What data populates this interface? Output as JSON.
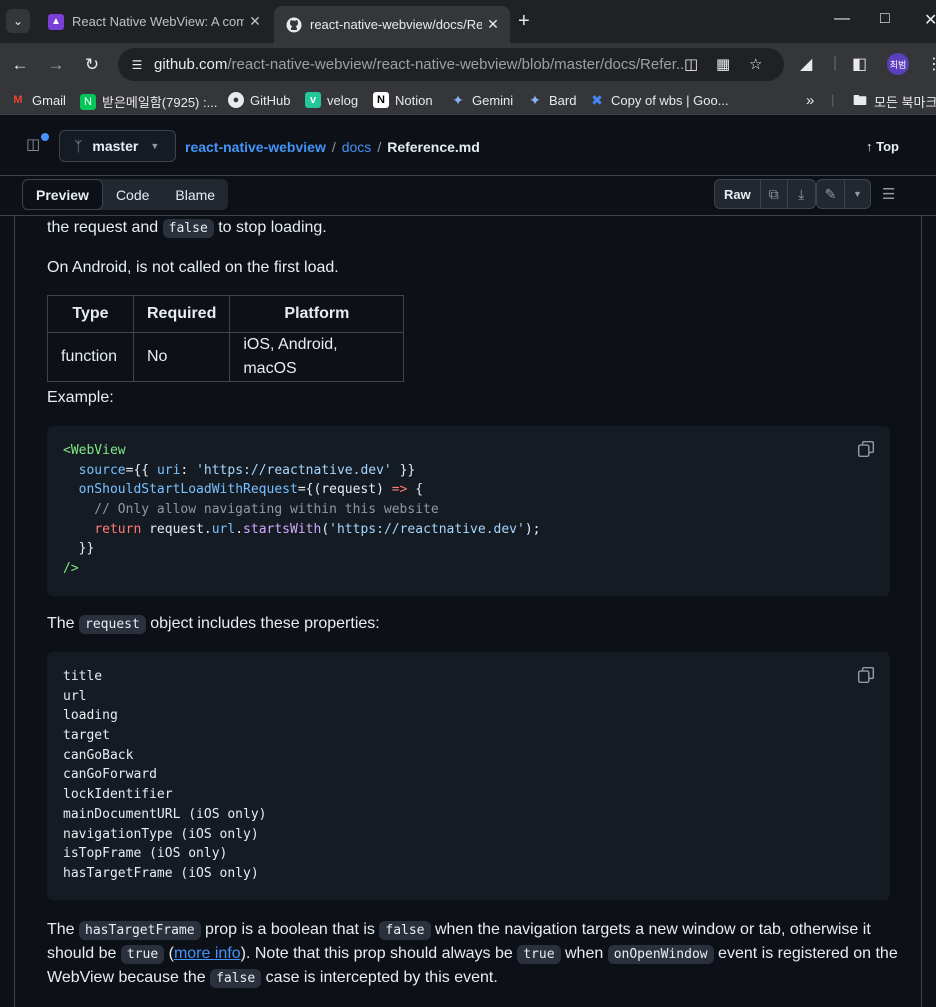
{
  "browser": {
    "tabs": [
      {
        "title": "React Native WebView: A com",
        "active": false
      },
      {
        "title": "react-native-webview/docs/Ref",
        "active": true
      }
    ],
    "url_domain": "github.com",
    "url_path": "/react-native-webview/react-native-webview/blob/master/docs/Refer...",
    "avatar_text": "최범",
    "bookmarks": [
      "Gmail",
      "받은메일함(7925) :...",
      "GitHub",
      "velog",
      "Notion",
      "Gemini",
      "Bard",
      "Copy of wbs | Goo...",
      "모든 북마크"
    ]
  },
  "file_header": {
    "branch": "master",
    "crumbs": [
      "react-native-webview",
      "docs",
      "Reference.md"
    ],
    "top_label": "Top",
    "views": [
      "Preview",
      "Code",
      "Blame"
    ],
    "raw_label": "Raw"
  },
  "content": {
    "p1_pre": "the request and ",
    "p1_code": "false",
    "p1_post": " to stop loading.",
    "p2": "On Android, is not called on the first load.",
    "table": {
      "headers": [
        "Type",
        "Required",
        "Platform"
      ],
      "row": [
        "function",
        "No",
        "iOS, Android, macOS"
      ]
    },
    "example_label": "Example:",
    "code1": [
      "<WebView",
      "  source={{ uri: 'https://reactnative.dev' }}",
      "  onShouldStartLoadWithRequest={(request) => {",
      "    // Only allow navigating within this website",
      "    return request.url.startsWith('https://reactnative.dev');",
      "  }}",
      "/>"
    ],
    "p3_pre": "The ",
    "p3_code": "request",
    "p3_post": " object includes these properties:",
    "code2": [
      "title",
      "url",
      "loading",
      "target",
      "canGoBack",
      "canGoForward",
      "lockIdentifier",
      "mainDocumentURL (iOS only)",
      "navigationType (iOS only)",
      "isTopFrame (iOS only)",
      "hasTargetFrame (iOS only)"
    ],
    "p4": {
      "t1": "The ",
      "c1": "hasTargetFrame",
      "t2": " prop is a boolean that is ",
      "c2": "false",
      "t3": " when the navigation targets a new window or tab, otherwise it",
      "t4": "should be ",
      "c3": "true",
      "t5": " (",
      "link": "more info",
      "t6": "). Note that this prop should always be ",
      "c4": "true",
      "t7": " when ",
      "c5": "onOpenWindow",
      "t8": " event is registered on the",
      "t9": "WebView because the ",
      "c6": "false",
      "t10": " case is intercepted by this event."
    }
  }
}
